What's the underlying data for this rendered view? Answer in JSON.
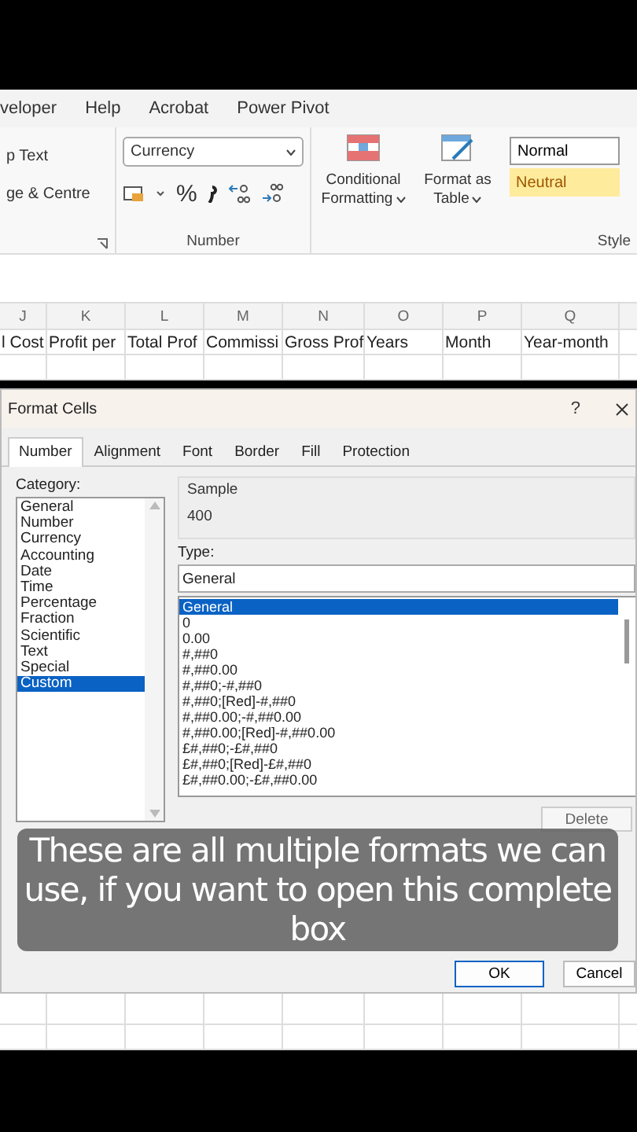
{
  "ribbon_tabs": [
    "veloper",
    "Help",
    "Acrobat",
    "Power Pivot"
  ],
  "ribbon": {
    "alignment_items": [
      "p Text",
      "ge & Centre"
    ],
    "number_format": "Currency",
    "number_buttons": [
      "%"
    ],
    "number_group_label": "Number",
    "styles_buttons": [
      "Conditional Formatting",
      "Format as Table"
    ],
    "style_cells": [
      {
        "label": "Normal",
        "kind": "normal"
      },
      {
        "label": "Neutral",
        "kind": "neutral"
      }
    ],
    "styles_group_label": "Style"
  },
  "columns": [
    "J",
    "K",
    "L",
    "M",
    "N",
    "O",
    "P",
    "Q"
  ],
  "header_row": [
    "l Cost",
    "Profit per",
    "Total Prof",
    "Commissi",
    "Gross Prof",
    "Years",
    "Month",
    "Year-month"
  ],
  "dialog": {
    "title": "Format Cells",
    "help": "?",
    "tabs": [
      {
        "label": "Number",
        "selected": true
      },
      {
        "label": "Alignment",
        "selected": false
      },
      {
        "label": "Font",
        "selected": false
      },
      {
        "label": "Border",
        "selected": false
      },
      {
        "label": "Fill",
        "selected": false
      },
      {
        "label": "Protection",
        "selected": false
      }
    ],
    "category_label": "Category:",
    "categories": [
      {
        "label": "General",
        "selected": false
      },
      {
        "label": "Number",
        "selected": false
      },
      {
        "label": "Currency",
        "selected": false
      },
      {
        "label": "Accounting",
        "selected": false
      },
      {
        "label": "Date",
        "selected": false
      },
      {
        "label": "Time",
        "selected": false
      },
      {
        "label": "Percentage",
        "selected": false
      },
      {
        "label": "Fraction",
        "selected": false
      },
      {
        "label": "Scientific",
        "selected": false
      },
      {
        "label": "Text",
        "selected": false
      },
      {
        "label": "Special",
        "selected": false
      },
      {
        "label": "Custom",
        "selected": true
      }
    ],
    "sample_label": "Sample",
    "sample_value": "400",
    "type_label": "Type:",
    "type_value": "General",
    "types": [
      {
        "label": "General",
        "selected": true
      },
      {
        "label": "0",
        "selected": false
      },
      {
        "label": "0.00",
        "selected": false
      },
      {
        "label": "#,##0",
        "selected": false
      },
      {
        "label": "#,##0.00",
        "selected": false
      },
      {
        "label": "#,##0;-#,##0",
        "selected": false
      },
      {
        "label": "#,##0;[Red]-#,##0",
        "selected": false
      },
      {
        "label": "#,##0.00;-#,##0.00",
        "selected": false
      },
      {
        "label": "#,##0.00;[Red]-#,##0.00",
        "selected": false
      },
      {
        "label": "£#,##0;-£#,##0",
        "selected": false
      },
      {
        "label": "£#,##0;[Red]-£#,##0",
        "selected": false
      },
      {
        "label": "£#,##0.00;-£#,##0.00",
        "selected": false
      }
    ],
    "delete_button": "Delete",
    "ok_button": "OK",
    "cancel_button": "Cancel"
  },
  "caption": "These are all multiple formats we can use, if you want to open this complete box"
}
